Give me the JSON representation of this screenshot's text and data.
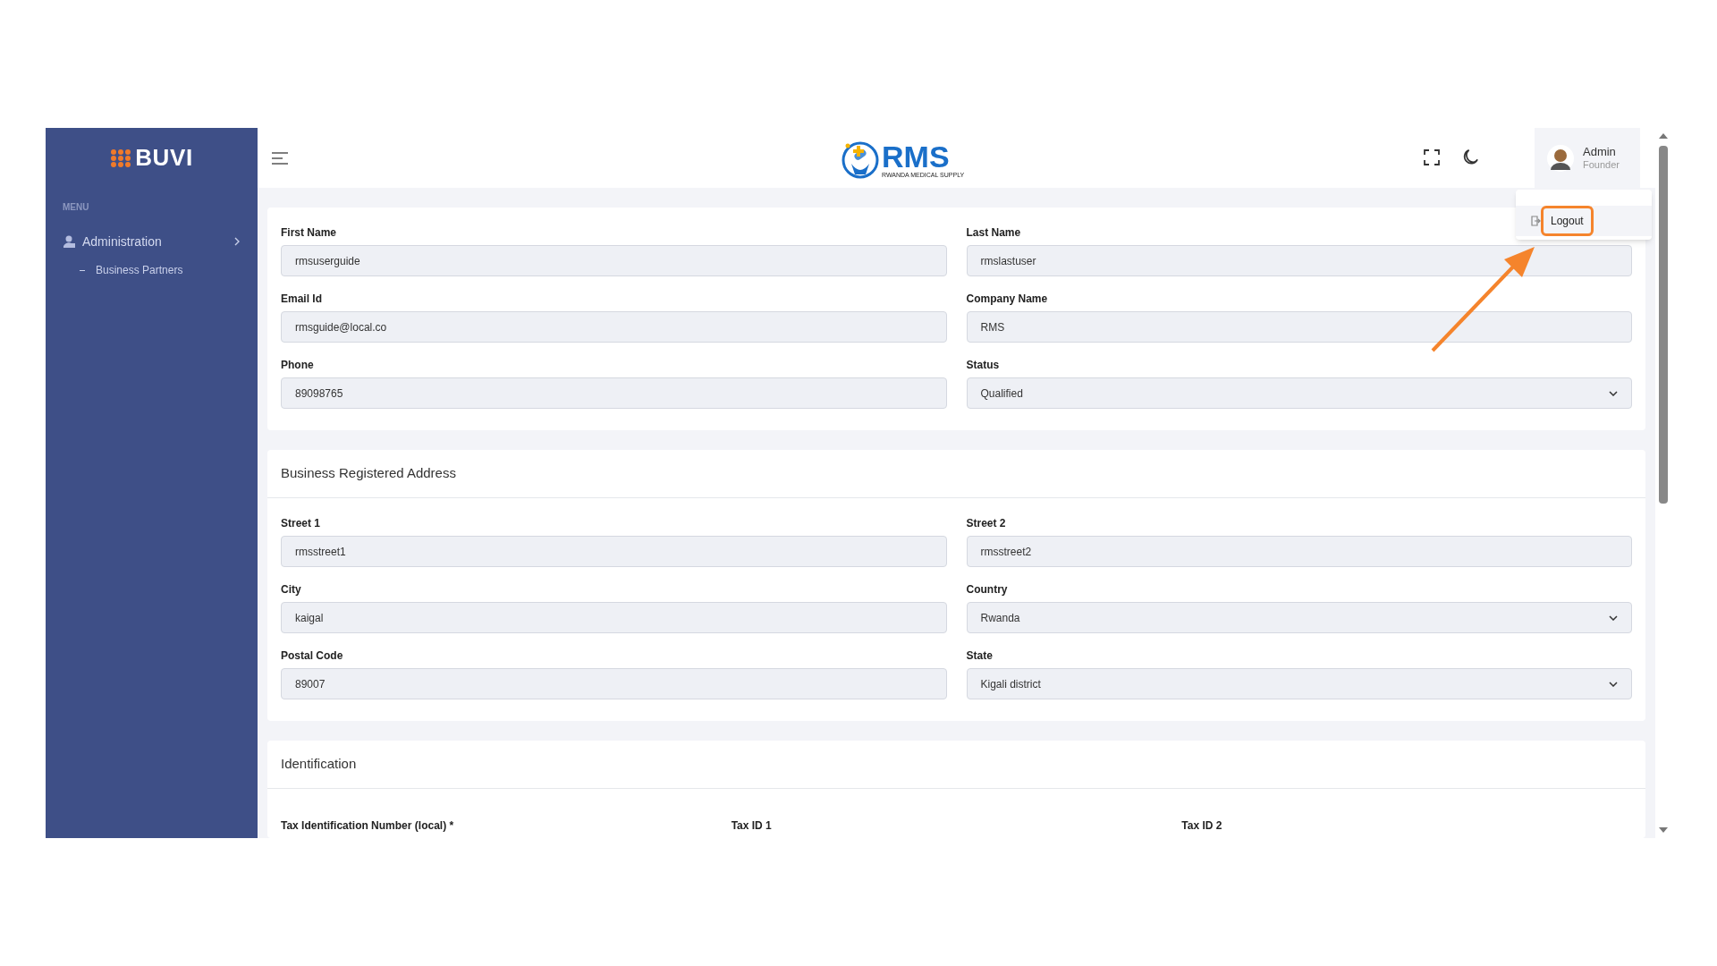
{
  "sidebar": {
    "logo": "BUVI",
    "menu_heading": "MENU",
    "items": [
      {
        "label": "Administration",
        "expanded": true,
        "children": [
          {
            "label": "Business Partners"
          }
        ]
      }
    ]
  },
  "header": {
    "brand": {
      "name": "RMS",
      "tagline": "RWANDA MEDICAL SUPPLY"
    },
    "user": {
      "name": "Admin",
      "role": "Founder"
    },
    "user_menu": {
      "items": [
        {
          "label": "Logout",
          "highlighted": true
        }
      ]
    }
  },
  "profile": {
    "fields": [
      {
        "label": "First Name",
        "value": "rmsuserguide",
        "kind": "input"
      },
      {
        "label": "Last Name",
        "value": "rmslastuser",
        "kind": "input"
      },
      {
        "label": "Email Id",
        "value": "rmsguide@local.co",
        "kind": "input"
      },
      {
        "label": "Company Name",
        "value": "RMS",
        "kind": "input"
      },
      {
        "label": "Phone",
        "value": "89098765",
        "kind": "input"
      },
      {
        "label": "Status",
        "value": "Qualified",
        "kind": "select"
      }
    ]
  },
  "address": {
    "title": "Business Registered Address",
    "fields": [
      {
        "label": "Street 1",
        "value": "rmsstreet1",
        "kind": "input"
      },
      {
        "label": "Street 2",
        "value": "rmsstreet2",
        "kind": "input"
      },
      {
        "label": "City",
        "value": "kaigal",
        "kind": "input"
      },
      {
        "label": "Country",
        "value": "Rwanda",
        "kind": "select"
      },
      {
        "label": "Postal Code",
        "value": "89007",
        "kind": "input"
      },
      {
        "label": "State",
        "value": "Kigali district",
        "kind": "select"
      }
    ]
  },
  "identification": {
    "title": "Identification",
    "labels": [
      "Tax Identification Number (local) *",
      "Tax ID 1",
      "Tax ID 2"
    ]
  }
}
